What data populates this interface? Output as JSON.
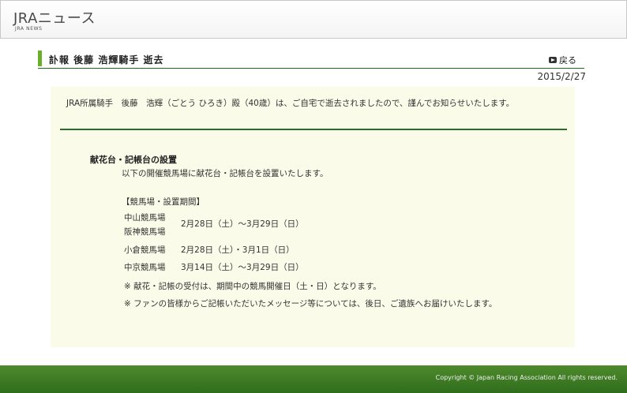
{
  "header": {
    "title": "JRAニュース",
    "subtitle": "JRA NEWS"
  },
  "article": {
    "title": "訃報 後藤 浩輝騎手 逝去",
    "back_label": "戻る",
    "date": "2015/2/27",
    "intro": "JRA所属騎手　後藤　浩輝（ごとう ひろき）殿（40歳）は、ご自宅で逝去されましたので、謹んでお知らせいたします。"
  },
  "section": {
    "title": "献花台・記帳台の設置",
    "description": "以下の開催競馬場に献花台・記帳台を設置いたします。",
    "venues_heading": "【競馬場・設置期間】",
    "venues": [
      {
        "names": [
          "中山競馬場",
          "阪神競馬場"
        ],
        "period": "2月28日（土）～3月29日（日）"
      },
      {
        "names": [
          "小倉競馬場"
        ],
        "period": "2月28日（土）・3月1日（日）"
      },
      {
        "names": [
          "中京競馬場"
        ],
        "period": "3月14日（土）～3月29日（日）"
      }
    ],
    "notes": [
      "※ 献花・記帳の受付は、期間中の競馬開催日（土・日）となります。",
      "※ ファンの皆様からご記帳いただいたメッセージ等については、後日、ご遺族へお届けいたします。"
    ]
  },
  "footer": {
    "copyright": "Copyright © Japan Racing Association All rights reserved."
  },
  "colors": {
    "accent_green": "#6aaf28",
    "divider_green": "#2a6a2a",
    "panel_bg": "#fbfbea",
    "footer_green": "#3d7a23"
  }
}
